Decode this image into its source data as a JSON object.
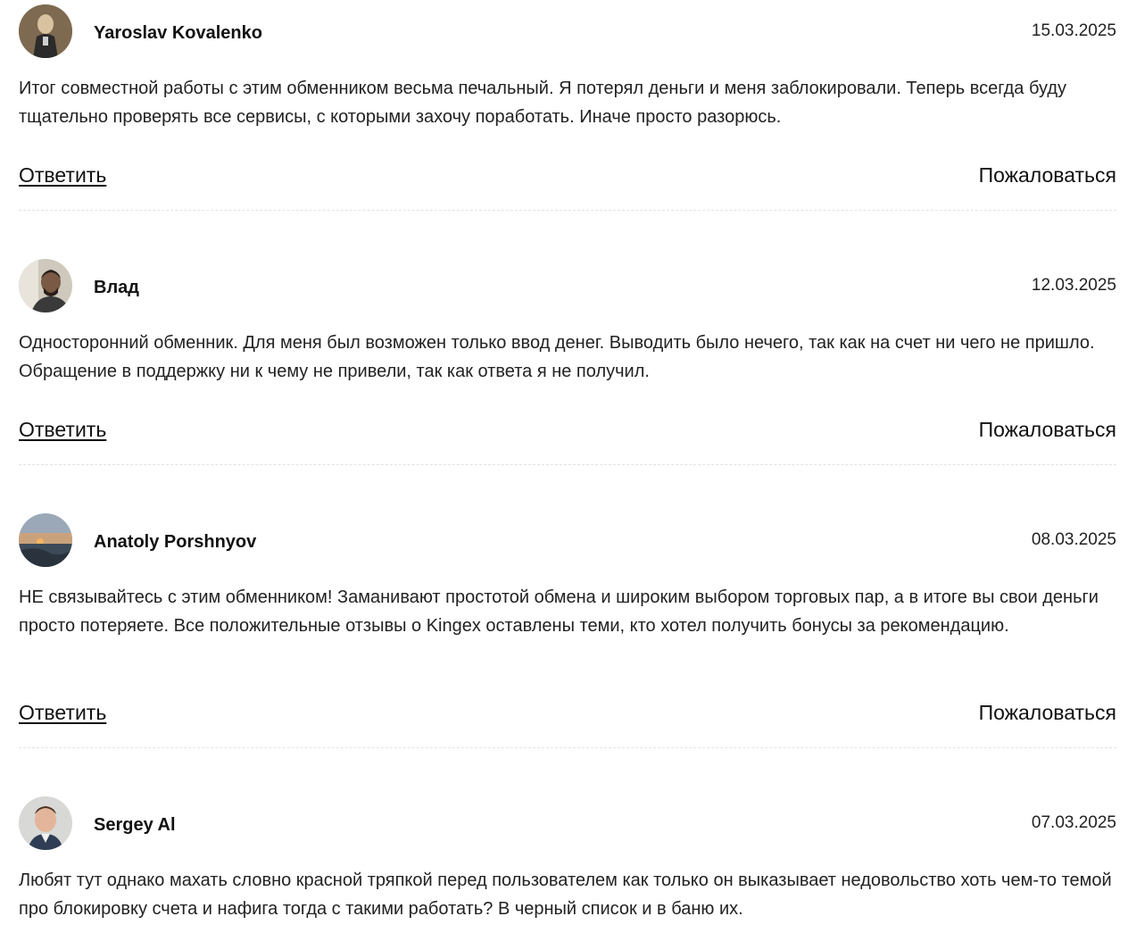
{
  "comments": [
    {
      "author": "Yaroslav Kovalenko",
      "date": "15.03.2025",
      "text": "Итог совместной работы с этим обменником весьма печальный. Я потерял деньги и меня заблокировали. Теперь всегда буду тщательно проверять все сервисы, с которыми захочу поработать. Иначе просто разорюсь.",
      "reply_label": "Ответить",
      "report_label": "Пожаловаться"
    },
    {
      "author": "Влад",
      "date": "12.03.2025",
      "text": "Односторонний обменник. Для меня был возможен только ввод денег. Выводить было нечего, так как на счет ни чего не пришло. Обращение в поддержку ни к чему не привели, так как ответа я не получил.",
      "reply_label": "Ответить",
      "report_label": "Пожаловаться"
    },
    {
      "author": "Anatoly Porshnyov",
      "date": "08.03.2025",
      "text": "НЕ связывайтесь с этим обменником! Заманивают простотой обмена и широким выбором торговых пар, а в итоге вы свои деньги просто потеряете. Все положительные отзывы о Kingex оставлены теми, кто хотел получить бонусы за рекомендацию.",
      "reply_label": "Ответить",
      "report_label": "Пожаловаться"
    },
    {
      "author": "Sergey Al",
      "date": "07.03.2025",
      "text": "Любят тут однако махать словно красной тряпкой перед пользователем как только он выказывает недовольство хоть чем-то темой про блокировку счета и нафига тогда с такими работать? В черный список и в баню их."
    }
  ]
}
